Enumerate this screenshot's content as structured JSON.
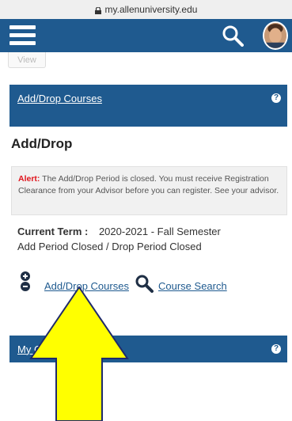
{
  "browser": {
    "url": "my.allenuniversity.edu"
  },
  "header": {
    "menu_icon": "hamburger-icon",
    "search_icon": "search-icon",
    "avatar": "user-avatar"
  },
  "view_button": {
    "label": "View"
  },
  "add_drop_panel": {
    "link": "Add/Drop Courses",
    "help": "?"
  },
  "main": {
    "title": "Add/Drop",
    "alert": {
      "prefix": "Alert:",
      "message": "The Add/Drop Period is closed. You must receive Registration Clearance from your Advisor before you can register. See your advisor."
    },
    "current_term": {
      "label": "Current Term :",
      "value": "2020-2021 - Fall Semester",
      "status": "Add Period Closed / Drop Period Closed"
    },
    "actions": {
      "add_drop_label": "Add/Drop Courses",
      "course_search_label": "Course Search"
    }
  },
  "gpa_panel": {
    "link": "My GPA",
    "link_suffix": "t",
    "help": "?"
  },
  "annotation": {
    "type": "up-arrow",
    "color": "#ffff00"
  }
}
